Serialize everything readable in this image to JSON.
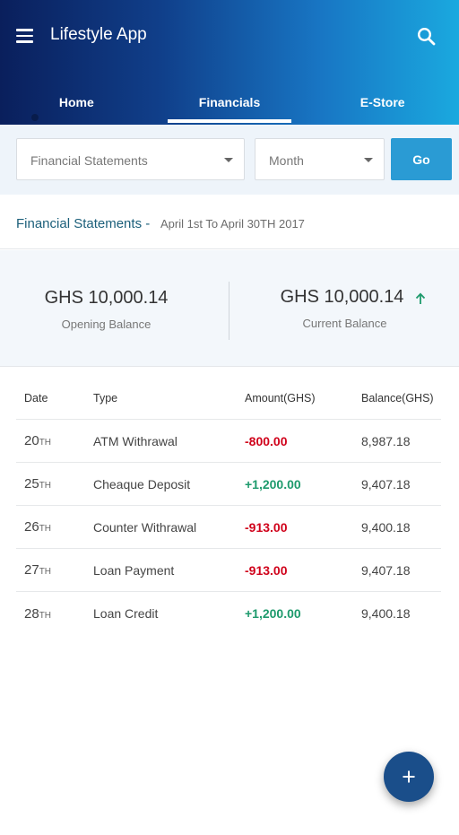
{
  "app": {
    "title": "Lifestyle App"
  },
  "tabs": [
    {
      "label": "Home",
      "active": false
    },
    {
      "label": "Financials",
      "active": true
    },
    {
      "label": "E-Store",
      "active": false
    }
  ],
  "filters": {
    "statement_select": "Financial Statements",
    "month_select": "Month",
    "go_label": "Go"
  },
  "statement": {
    "title": "Financial Statements -",
    "range": "April 1st To April 30TH 2017"
  },
  "balances": {
    "opening": {
      "amount": "GHS 10,000.14",
      "label": "Opening Balance"
    },
    "current": {
      "amount": "GHS 10,000.14",
      "label": "Current Balance",
      "trend": "up"
    }
  },
  "table": {
    "headers": {
      "date": "Date",
      "type": "Type",
      "amount": "Amount(GHS)",
      "balance": "Balance(GHS)"
    },
    "rows": [
      {
        "day": "20",
        "suffix": "TH",
        "type": "ATM Withrawal",
        "amount": "-800.00",
        "sign": "neg",
        "balance": "8,987.18"
      },
      {
        "day": "25",
        "suffix": "TH",
        "type": "Cheaque Deposit",
        "amount": "+1,200.00",
        "sign": "pos",
        "balance": "9,407.18"
      },
      {
        "day": "26",
        "suffix": "TH",
        "type": "Counter Withrawal",
        "amount": "-913.00",
        "sign": "neg",
        "balance": "9,400.18"
      },
      {
        "day": "27",
        "suffix": "TH",
        "type": "Loan Payment",
        "amount": "-913.00",
        "sign": "neg",
        "balance": "9,407.18"
      },
      {
        "day": "28",
        "suffix": "TH",
        "type": "Loan Credit",
        "amount": "+1,200.00",
        "sign": "pos",
        "balance": "9,400.18"
      }
    ]
  },
  "colors": {
    "accent": "#2a9bd4",
    "negative": "#d0021b",
    "positive": "#1d9a6c",
    "fab": "#1a4e8a"
  },
  "icons": {
    "menu": "menu-icon",
    "search": "search-icon",
    "trend": "arrow-up-icon",
    "fab": "plus-icon"
  }
}
